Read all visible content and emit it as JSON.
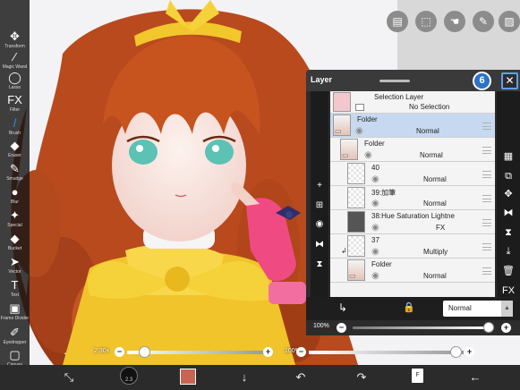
{
  "left_toolbar": [
    {
      "label": "Transform",
      "icon": "move-arrows-icon",
      "glyph": "✥"
    },
    {
      "label": "Magic Wand",
      "icon": "magic-wand-icon",
      "glyph": "⁄"
    },
    {
      "label": "Lasso",
      "icon": "lasso-icon",
      "glyph": "◯"
    },
    {
      "label": "Filter",
      "icon": "fx-filter-icon",
      "glyph": "FX"
    },
    {
      "label": "Brush",
      "icon": "brush-icon",
      "glyph": "/"
    },
    {
      "label": "Eraser",
      "icon": "eraser-icon",
      "glyph": "◆"
    },
    {
      "label": "Smudge",
      "icon": "smudge-icon",
      "glyph": "✎"
    },
    {
      "label": "Blur",
      "icon": "blur-drop-icon",
      "glyph": "●"
    },
    {
      "label": "Special",
      "icon": "special-brush-icon",
      "glyph": "✦"
    },
    {
      "label": "Bucket",
      "icon": "bucket-icon",
      "glyph": "◆"
    },
    {
      "label": "Vector",
      "icon": "vector-cursor-icon",
      "glyph": "➤"
    },
    {
      "label": "Text",
      "icon": "text-icon",
      "glyph": "T"
    },
    {
      "label": "Frame Divider",
      "icon": "frame-divider-icon",
      "glyph": "▣"
    },
    {
      "label": "Eyedropper",
      "icon": "eyedropper-icon",
      "glyph": "✐"
    },
    {
      "label": "Canvas",
      "icon": "canvas-icon",
      "glyph": "▢"
    }
  ],
  "top_actions": [
    {
      "name": "layer-option-icon",
      "glyph": "▤"
    },
    {
      "name": "selection-icon",
      "glyph": "⬚"
    },
    {
      "name": "hand-icon",
      "glyph": "☚"
    },
    {
      "name": "pen-icon",
      "glyph": "✎"
    },
    {
      "name": "image-icon",
      "glyph": "▨"
    }
  ],
  "layer_panel": {
    "title": "Layer",
    "badge": "6",
    "close_glyph": "✕",
    "layers": [
      {
        "name": "Selection Layer",
        "mode": "No Selection",
        "thumb": "pink",
        "indent": 0,
        "selected": false,
        "type": "selection"
      },
      {
        "name": "Folder",
        "mode": "Normal",
        "thumb": "art",
        "indent": 0,
        "selected": true,
        "type": "folder"
      },
      {
        "name": "Folder",
        "mode": "Normal",
        "thumb": "art",
        "indent": 1,
        "selected": false,
        "type": "folder"
      },
      {
        "name": "40",
        "mode": "Normal",
        "thumb": "check",
        "indent": 2,
        "selected": false,
        "type": "layer"
      },
      {
        "name": "39:加筆",
        "mode": "Normal",
        "thumb": "check",
        "indent": 2,
        "selected": false,
        "type": "layer"
      },
      {
        "name": "38:Hue Saturation Lightne",
        "mode": "FX",
        "thumb": "dark",
        "indent": 2,
        "selected": false,
        "type": "layer"
      },
      {
        "name": "37",
        "mode": "Multiply",
        "thumb": "check",
        "indent": 2,
        "selected": false,
        "type": "clip"
      },
      {
        "name": "Folder",
        "mode": "Normal",
        "thumb": "art",
        "indent": 2,
        "selected": false,
        "type": "folder"
      }
    ],
    "left_side": [
      {
        "name": "add-layer-icon",
        "glyph": "+"
      },
      {
        "name": "add-special-layer-icon",
        "glyph": "⊞"
      },
      {
        "name": "camera-icon",
        "glyph": "◉"
      },
      {
        "name": "flip-horizontal-icon",
        "glyph": "⧓"
      },
      {
        "name": "flip-vertical-icon",
        "glyph": "⧗"
      }
    ],
    "right_side": [
      {
        "name": "checker-icon",
        "glyph": "▦"
      },
      {
        "name": "copy-layer-icon",
        "glyph": "⧉"
      },
      {
        "name": "move-layer-icon",
        "glyph": "✥"
      },
      {
        "name": "flip-h-icon",
        "glyph": "⧓"
      },
      {
        "name": "flip-v-icon",
        "glyph": "⧗"
      },
      {
        "name": "merge-down-icon",
        "glyph": "⤓"
      },
      {
        "name": "trash-icon",
        "glyph": "🗑"
      },
      {
        "name": "fx-icon",
        "glyph": "FX"
      },
      {
        "name": "more-icon",
        "glyph": "⋮"
      }
    ],
    "blend_mode": "Normal",
    "opacity_label": "100%",
    "opacity": 100
  },
  "brush_size": {
    "label": "2.30x",
    "fraction": 0.02
  },
  "brush_opacity": {
    "label": "100%",
    "fraction": 1.0
  },
  "bottom_toolbar": [
    {
      "name": "transform-icon",
      "glyph": "⤡"
    },
    {
      "name": "brush-size-icon",
      "glyph": "●"
    },
    {
      "name": "color-icon",
      "glyph": "■"
    },
    {
      "name": "download-icon",
      "glyph": "↓"
    },
    {
      "name": "undo-icon",
      "glyph": "↶"
    },
    {
      "name": "redo-icon",
      "glyph": "↷"
    },
    {
      "name": "page-icon",
      "glyph": "F"
    },
    {
      "name": "back-arrow-icon",
      "glyph": "←"
    }
  ],
  "brush_preview_label": "2.3",
  "color_hex": "#c86452",
  "page_label": "F"
}
